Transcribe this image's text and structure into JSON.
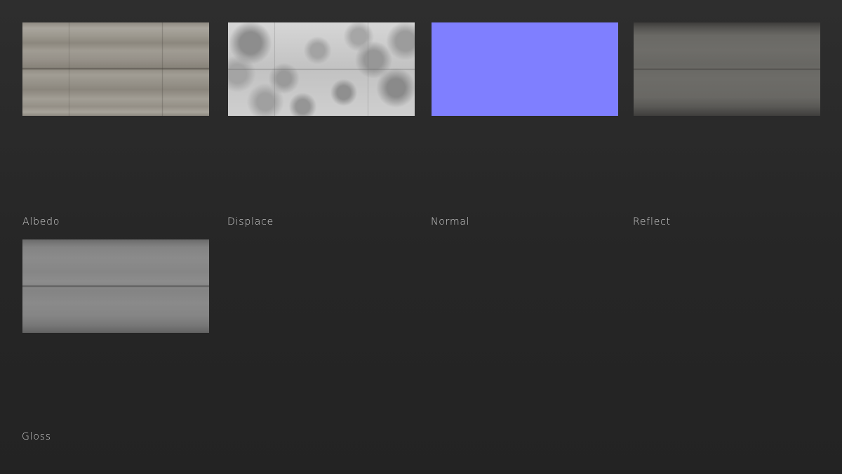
{
  "maps": [
    {
      "label": "Albedo",
      "color": "#a09c93"
    },
    {
      "label": "Displace",
      "color": "#c9c9c9"
    },
    {
      "label": "Normal",
      "color": "#7f7fff"
    },
    {
      "label": "Reflect",
      "color": "#6a6965"
    },
    {
      "label": "Gloss",
      "color": "#878787"
    }
  ]
}
